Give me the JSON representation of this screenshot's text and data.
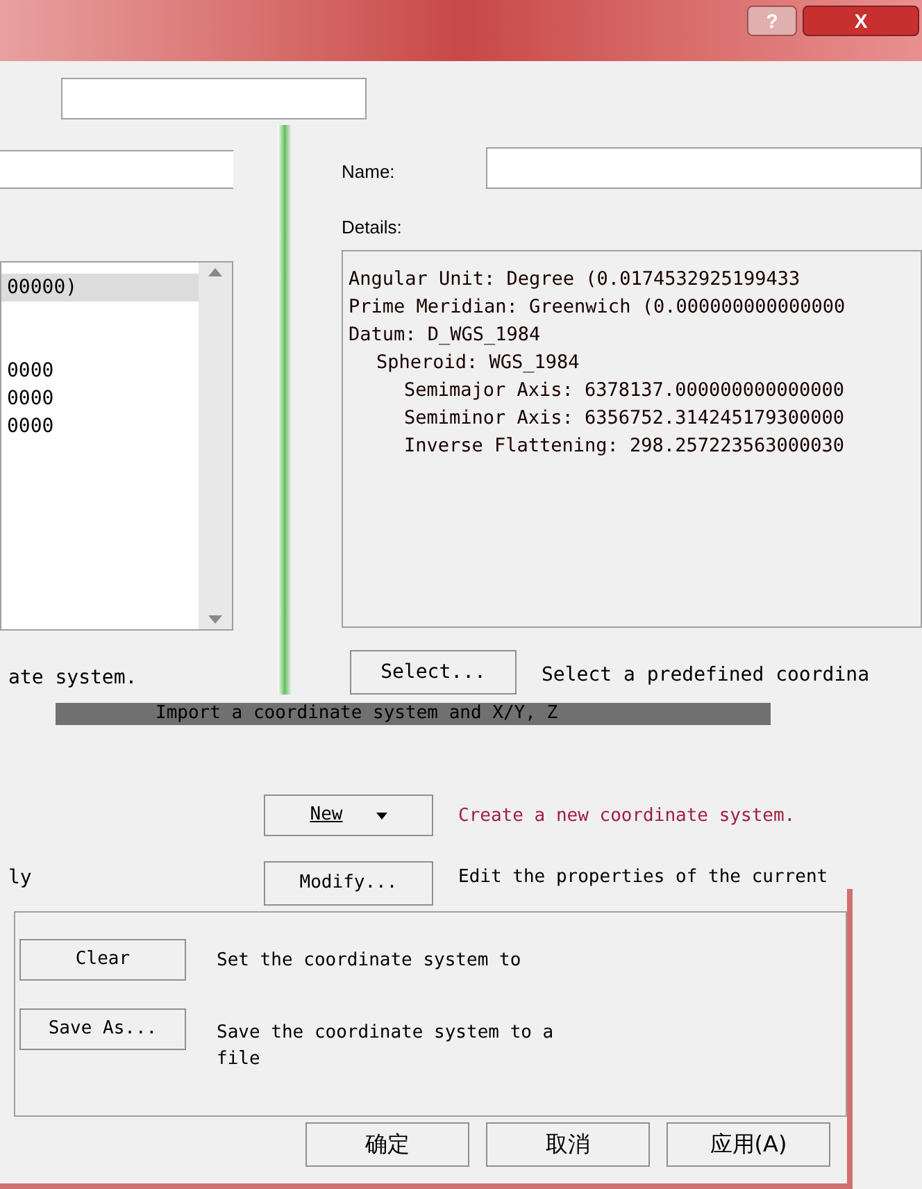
{
  "window": {
    "help_button": "?",
    "close_button": "X"
  },
  "left_panel": {
    "list_lines": [
      {
        "text": "00000)",
        "selected": true
      },
      {
        "text": "0000",
        "selected": false
      },
      {
        "text": "0000",
        "selected": false
      },
      {
        "text": "0000",
        "selected": false
      }
    ],
    "caption": "ate system.",
    "caption_2": "ly"
  },
  "name_label": "Name:",
  "details_label": "Details:",
  "details": [
    {
      "text": "Angular Unit: Degree (0.0174532925199433"
    },
    {
      "text": "Prime Meridian: Greenwich (0.000000000000000"
    },
    {
      "text": "Datum: D_WGS_1984",
      "children": [
        {
          "text": "Spheroid: WGS_1984",
          "children": [
            {
              "text": "Semimajor Axis: 6378137.000000000000000"
            },
            {
              "text": "Semiminor Axis: 6356752.314245179300000"
            },
            {
              "text": "Inverse Flattening: 298.257223563000030"
            }
          ]
        }
      ]
    }
  ],
  "select": {
    "button": "Select...",
    "description": "Select a predefined coordina"
  },
  "import_banner": "Import a coordinate system and X/Y, Z",
  "new": {
    "button": "New",
    "description": "Create a new coordinate system."
  },
  "modify": {
    "button": "Modify...",
    "description": "Edit the properties of the current"
  },
  "clear": {
    "button": "Clear",
    "description": "Set the coordinate system to"
  },
  "save_as": {
    "button": "Save As...",
    "description": "Save the coordinate system to a file"
  },
  "buttons": [
    "确定",
    "取消",
    "应用(A)"
  ]
}
